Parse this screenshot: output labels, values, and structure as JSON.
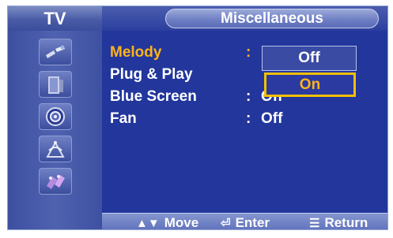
{
  "header": {
    "left_label": "TV",
    "title": "Miscellaneous"
  },
  "sidebar": {
    "icons": [
      "input-icon",
      "picture-icon",
      "sound-icon",
      "channel-icon",
      "setup-icon"
    ]
  },
  "menu": {
    "items": [
      {
        "label": "Melody",
        "colon": ":",
        "value": ""
      },
      {
        "label": "Plug & Play",
        "colon": "",
        "value": ""
      },
      {
        "label": "Blue Screen",
        "colon": ":",
        "value": "Off"
      },
      {
        "label": "Fan",
        "colon": ":",
        "value": "Off"
      }
    ]
  },
  "dropdown": {
    "options": [
      "Off",
      "On"
    ],
    "highlighted": "On"
  },
  "footer": {
    "move": "Move",
    "enter": "Enter",
    "return": "Return"
  },
  "colors": {
    "background": "#22369c",
    "highlight": "#ffb31a",
    "selection_border": "#f2c000"
  }
}
